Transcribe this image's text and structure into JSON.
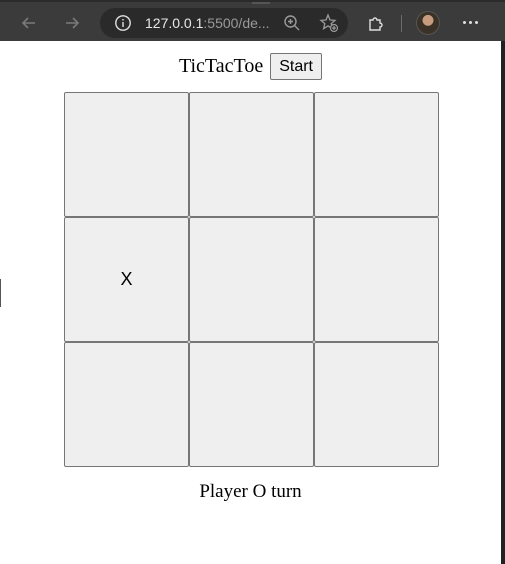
{
  "browser": {
    "url_host": "127.0.0.1",
    "url_rest": ":5500/de..."
  },
  "page": {
    "title": "TicTacToe",
    "start_label": "Start",
    "status": "Player O turn"
  },
  "board": {
    "cells": [
      "",
      "",
      "",
      "X",
      "",
      "",
      "",
      "",
      ""
    ]
  }
}
